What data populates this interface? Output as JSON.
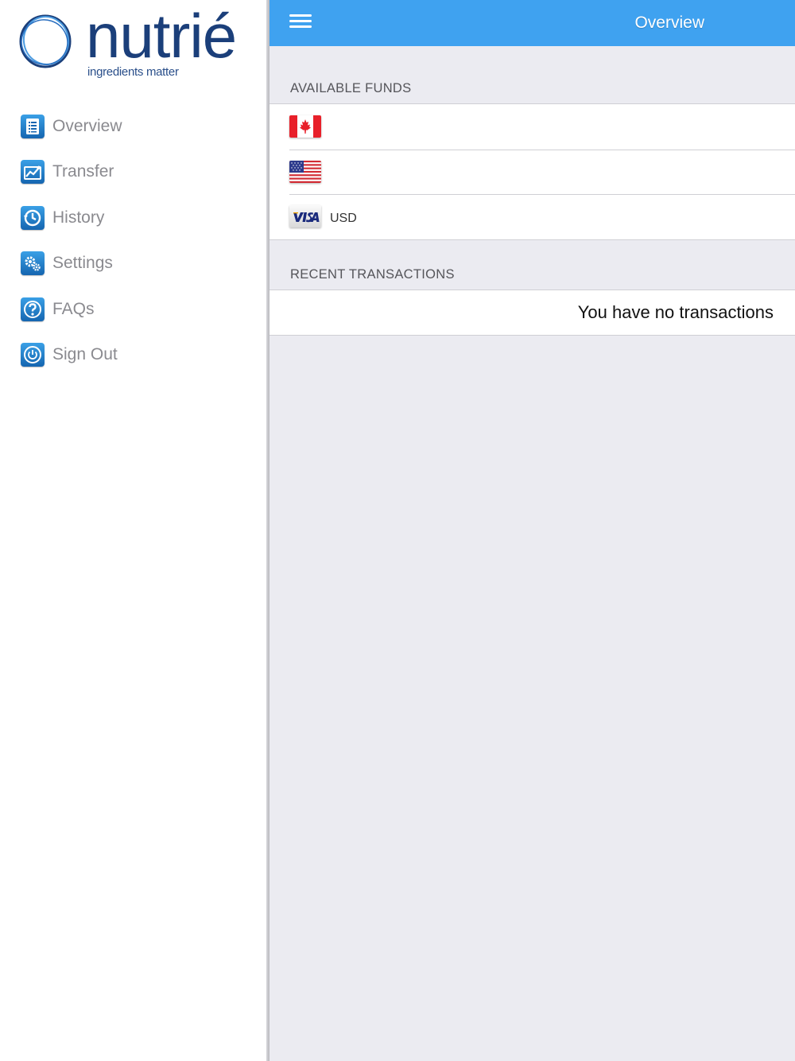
{
  "brand": {
    "name": "nutrié",
    "tagline": "ingredients matter"
  },
  "sidebar": {
    "items": [
      {
        "label": "Overview",
        "icon": "document-list-icon"
      },
      {
        "label": "Transfer",
        "icon": "transfer-chart-icon"
      },
      {
        "label": "History",
        "icon": "history-clock-icon"
      },
      {
        "label": "Settings",
        "icon": "gears-icon"
      },
      {
        "label": "FAQs",
        "icon": "question-icon"
      },
      {
        "label": "Sign Out",
        "icon": "power-icon"
      }
    ]
  },
  "header": {
    "title": "Overview",
    "menu_icon": "hamburger-menu-icon"
  },
  "funds": {
    "section_title": "AVAILABLE FUNDS",
    "rows": [
      {
        "icon": "canada-flag-icon",
        "currency": ""
      },
      {
        "icon": "usa-flag-icon",
        "currency": ""
      },
      {
        "icon": "visa-card-icon",
        "currency": "USD"
      }
    ]
  },
  "transactions": {
    "section_title": "RECENT TRANSACTIONS",
    "empty_message": "You have no transactions"
  },
  "colors": {
    "header_blue": "#3fa2f0",
    "icon_blue": "#1565b0",
    "nav_text": "#8a8a8f",
    "main_background": "#ebebf1",
    "brand_navy": "#1b3f7a"
  }
}
